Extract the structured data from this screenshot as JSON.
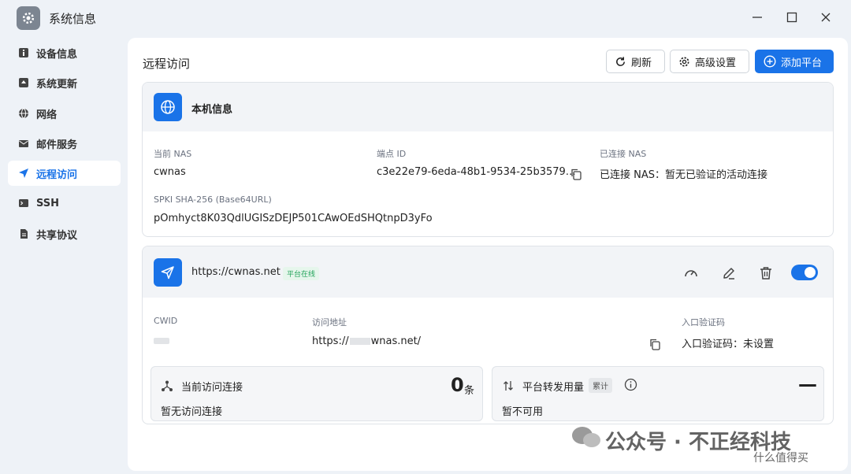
{
  "window": {
    "title": "系统信息"
  },
  "sidebar": {
    "items": [
      {
        "label": "设备信息",
        "icon": "info-icon"
      },
      {
        "label": "系统更新",
        "icon": "update-icon"
      },
      {
        "label": "网络",
        "icon": "globe-icon"
      },
      {
        "label": "邮件服务",
        "icon": "mail-icon"
      },
      {
        "label": "远程访问",
        "icon": "send-icon",
        "active": true
      },
      {
        "label": "SSH",
        "icon": "terminal-icon"
      },
      {
        "label": "共享协议",
        "icon": "document-icon"
      }
    ]
  },
  "main": {
    "title": "远程访问",
    "buttons": {
      "refresh": "刷新",
      "advanced": "高级设置",
      "add": "添加平台"
    }
  },
  "local": {
    "heading": "本机信息",
    "current_nas_label": "当前 NAS",
    "current_nas": "cwnas",
    "endpoint_label": "端点 ID",
    "endpoint": "c3e22e79-6eda-48b1-9534-25b3579…",
    "connected_label": "已连接 NAS",
    "connected": "已连接 NAS：暂无已验证的活动连接",
    "spki_label": "SPKI SHA-256 (Base64URL)",
    "spki": "pOmhyct8K03QdlUGISzDEJP501CAwOEdSHQtnpD3yFo"
  },
  "platform": {
    "url": "https://cwnas.net",
    "status": "平台在线",
    "cwid_label": "CWID",
    "access_label": "访问地址",
    "access_prefix": "https://",
    "access_suffix": "wnas.net/",
    "code_label": "入口验证码",
    "code_value": "入口验证码：未设置",
    "current_conn_label": "当前访问连接",
    "current_conn_count": "0",
    "current_conn_unit": "条",
    "current_conn_status": "暂无访问连接",
    "traffic_label": "平台转发用量",
    "traffic_tag": "累计",
    "traffic_value": "—",
    "traffic_status": "暂不可用"
  },
  "watermark": {
    "text": "公众号 · 不正经科技",
    "sub": "什么值得买"
  },
  "colors": {
    "accent": "#1a73e8",
    "online": "#22a35a"
  }
}
